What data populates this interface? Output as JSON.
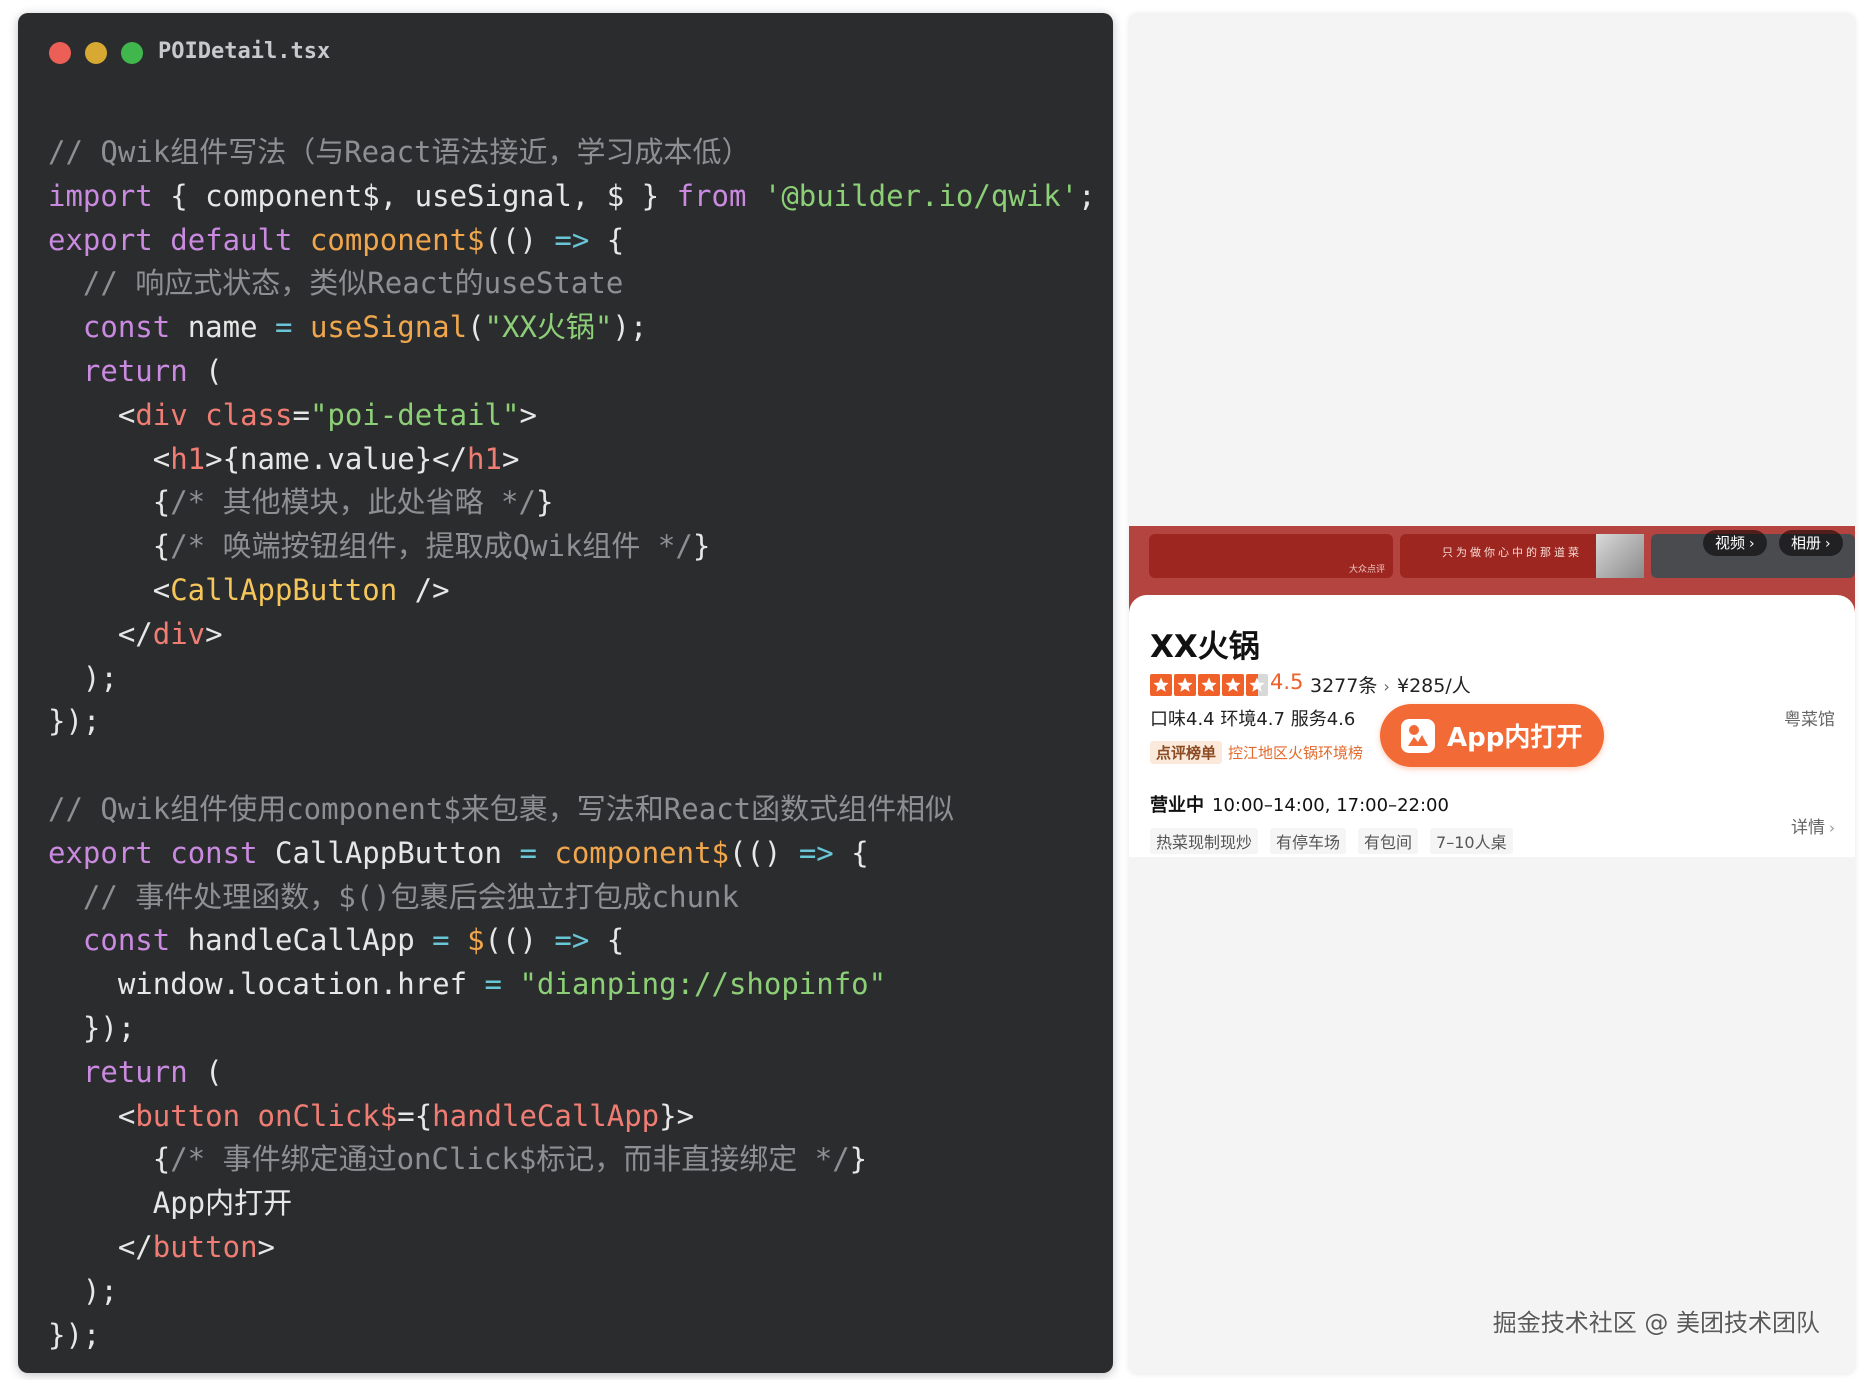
{
  "editor": {
    "filename": "POIDetail.tsx",
    "code_lines": [
      [
        {
          "t": "comment",
          "v": "// Qwik组件写法（与React语法接近，学习成本低）"
        }
      ],
      [
        {
          "t": "kw",
          "v": "import"
        },
        {
          "t": "plain",
          "v": " { component$, useSignal, $ } "
        },
        {
          "t": "kw",
          "v": "from"
        },
        {
          "t": "plain",
          "v": " "
        },
        {
          "t": "str",
          "v": "'@builder.io/qwik'"
        },
        {
          "t": "plain",
          "v": ";"
        }
      ],
      [
        {
          "t": "kw",
          "v": "export"
        },
        {
          "t": "plain",
          "v": " "
        },
        {
          "t": "kw",
          "v": "default"
        },
        {
          "t": "plain",
          "v": " "
        },
        {
          "t": "fn",
          "v": "component$"
        },
        {
          "t": "plain",
          "v": "(() "
        },
        {
          "t": "op",
          "v": "=>"
        },
        {
          "t": "plain",
          "v": " {"
        }
      ],
      [
        {
          "t": "plain",
          "v": "  "
        },
        {
          "t": "comment",
          "v": "// 响应式状态，类似React的useState"
        }
      ],
      [
        {
          "t": "plain",
          "v": "  "
        },
        {
          "t": "kw",
          "v": "const"
        },
        {
          "t": "plain",
          "v": " name "
        },
        {
          "t": "op",
          "v": "="
        },
        {
          "t": "plain",
          "v": " "
        },
        {
          "t": "fn",
          "v": "useSignal"
        },
        {
          "t": "plain",
          "v": "("
        },
        {
          "t": "str",
          "v": "\"XX火锅\""
        },
        {
          "t": "plain",
          "v": ");"
        }
      ],
      [
        {
          "t": "plain",
          "v": "  "
        },
        {
          "t": "kw",
          "v": "return"
        },
        {
          "t": "plain",
          "v": " ("
        }
      ],
      [
        {
          "t": "plain",
          "v": "    <"
        },
        {
          "t": "tag",
          "v": "div"
        },
        {
          "t": "plain",
          "v": " "
        },
        {
          "t": "attr",
          "v": "class"
        },
        {
          "t": "plain",
          "v": "="
        },
        {
          "t": "str",
          "v": "\"poi-detail\""
        },
        {
          "t": "plain",
          "v": ">"
        }
      ],
      [
        {
          "t": "plain",
          "v": "      <"
        },
        {
          "t": "tag",
          "v": "h1"
        },
        {
          "t": "plain",
          "v": ">{name.value}</"
        },
        {
          "t": "tag",
          "v": "h1"
        },
        {
          "t": "plain",
          "v": ">"
        }
      ],
      [
        {
          "t": "plain",
          "v": "      {"
        },
        {
          "t": "comment",
          "v": "/* 其他模块，此处省略 */"
        },
        {
          "t": "plain",
          "v": "}"
        }
      ],
      [
        {
          "t": "plain",
          "v": "      {"
        },
        {
          "t": "comment",
          "v": "/* 唤端按钮组件，提取成Qwik组件 */"
        },
        {
          "t": "plain",
          "v": "}"
        }
      ],
      [
        {
          "t": "plain",
          "v": "      <"
        },
        {
          "t": "comp",
          "v": "CallAppButton"
        },
        {
          "t": "plain",
          "v": " />"
        }
      ],
      [
        {
          "t": "plain",
          "v": "    </"
        },
        {
          "t": "tag",
          "v": "div"
        },
        {
          "t": "plain",
          "v": ">"
        }
      ],
      [
        {
          "t": "plain",
          "v": "  );"
        }
      ],
      [
        {
          "t": "plain",
          "v": "});"
        }
      ],
      [
        {
          "t": "plain",
          "v": ""
        }
      ],
      [
        {
          "t": "comment",
          "v": "// Qwik组件使用component$来包裹，写法和React函数式组件相似"
        }
      ],
      [
        {
          "t": "kw",
          "v": "export"
        },
        {
          "t": "plain",
          "v": " "
        },
        {
          "t": "kw",
          "v": "const"
        },
        {
          "t": "plain",
          "v": " CallAppButton "
        },
        {
          "t": "op",
          "v": "="
        },
        {
          "t": "plain",
          "v": " "
        },
        {
          "t": "fn",
          "v": "component$"
        },
        {
          "t": "plain",
          "v": "(() "
        },
        {
          "t": "op",
          "v": "=>"
        },
        {
          "t": "plain",
          "v": " {"
        }
      ],
      [
        {
          "t": "plain",
          "v": "  "
        },
        {
          "t": "comment",
          "v": "// 事件处理函数，$()包裹后会独立打包成chunk"
        }
      ],
      [
        {
          "t": "plain",
          "v": "  "
        },
        {
          "t": "kw",
          "v": "const"
        },
        {
          "t": "plain",
          "v": " handleCallApp "
        },
        {
          "t": "op",
          "v": "="
        },
        {
          "t": "plain",
          "v": " "
        },
        {
          "t": "fn",
          "v": "$"
        },
        {
          "t": "plain",
          "v": "(() "
        },
        {
          "t": "op",
          "v": "=>"
        },
        {
          "t": "plain",
          "v": " {"
        }
      ],
      [
        {
          "t": "plain",
          "v": "    window.location.href "
        },
        {
          "t": "op",
          "v": "="
        },
        {
          "t": "plain",
          "v": " "
        },
        {
          "t": "str",
          "v": "\"dianping://shopinfo\""
        }
      ],
      [
        {
          "t": "plain",
          "v": "  });"
        }
      ],
      [
        {
          "t": "plain",
          "v": "  "
        },
        {
          "t": "kw",
          "v": "return"
        },
        {
          "t": "plain",
          "v": " ("
        }
      ],
      [
        {
          "t": "plain",
          "v": "    <"
        },
        {
          "t": "tag",
          "v": "button"
        },
        {
          "t": "plain",
          "v": " "
        },
        {
          "t": "attr",
          "v": "onClick$"
        },
        {
          "t": "plain",
          "v": "={"
        },
        {
          "t": "tag",
          "v": "handleCallApp"
        },
        {
          "t": "plain",
          "v": "}>"
        }
      ],
      [
        {
          "t": "plain",
          "v": "      {"
        },
        {
          "t": "comment",
          "v": "/* 事件绑定通过onClick$标记，而非直接绑定 */"
        },
        {
          "t": "plain",
          "v": "}"
        }
      ],
      [
        {
          "t": "plain",
          "v": "      App内打开"
        }
      ],
      [
        {
          "t": "plain",
          "v": "    </"
        },
        {
          "t": "tag",
          "v": "button"
        },
        {
          "t": "plain",
          "v": ">"
        }
      ],
      [
        {
          "t": "plain",
          "v": "  );"
        }
      ],
      [
        {
          "t": "plain",
          "v": "});"
        }
      ]
    ]
  },
  "preview": {
    "banner": {
      "slogan": "只为做你心中的那道菜",
      "mini_label": "大众点评",
      "video_label": "视频",
      "album_label": "相册"
    },
    "shop": {
      "name": "XX火锅",
      "star_count": 4.5,
      "rating": "4.5",
      "reviews": "3277条",
      "price": "¥285/人",
      "scores": "口味4.4 环境4.7 服务4.6",
      "cuisine": "粤菜馆",
      "rank_tag": "点评榜单",
      "rank_text": "控江地区火锅环境榜",
      "open_app_label": "App内打开",
      "hours_status": "营业中",
      "hours": "10:00–14:00, 17:00–22:00",
      "features": [
        "热菜现制现炒",
        "有停车场",
        "有包间",
        "7–10人桌"
      ],
      "details": "详情"
    }
  },
  "watermark": "掘金技术社区 @ 美团技术团队",
  "colors": {
    "editor_bg": "#2b2c2e",
    "accent_orange": "#f26a35",
    "banner_red": "#b4443f"
  }
}
